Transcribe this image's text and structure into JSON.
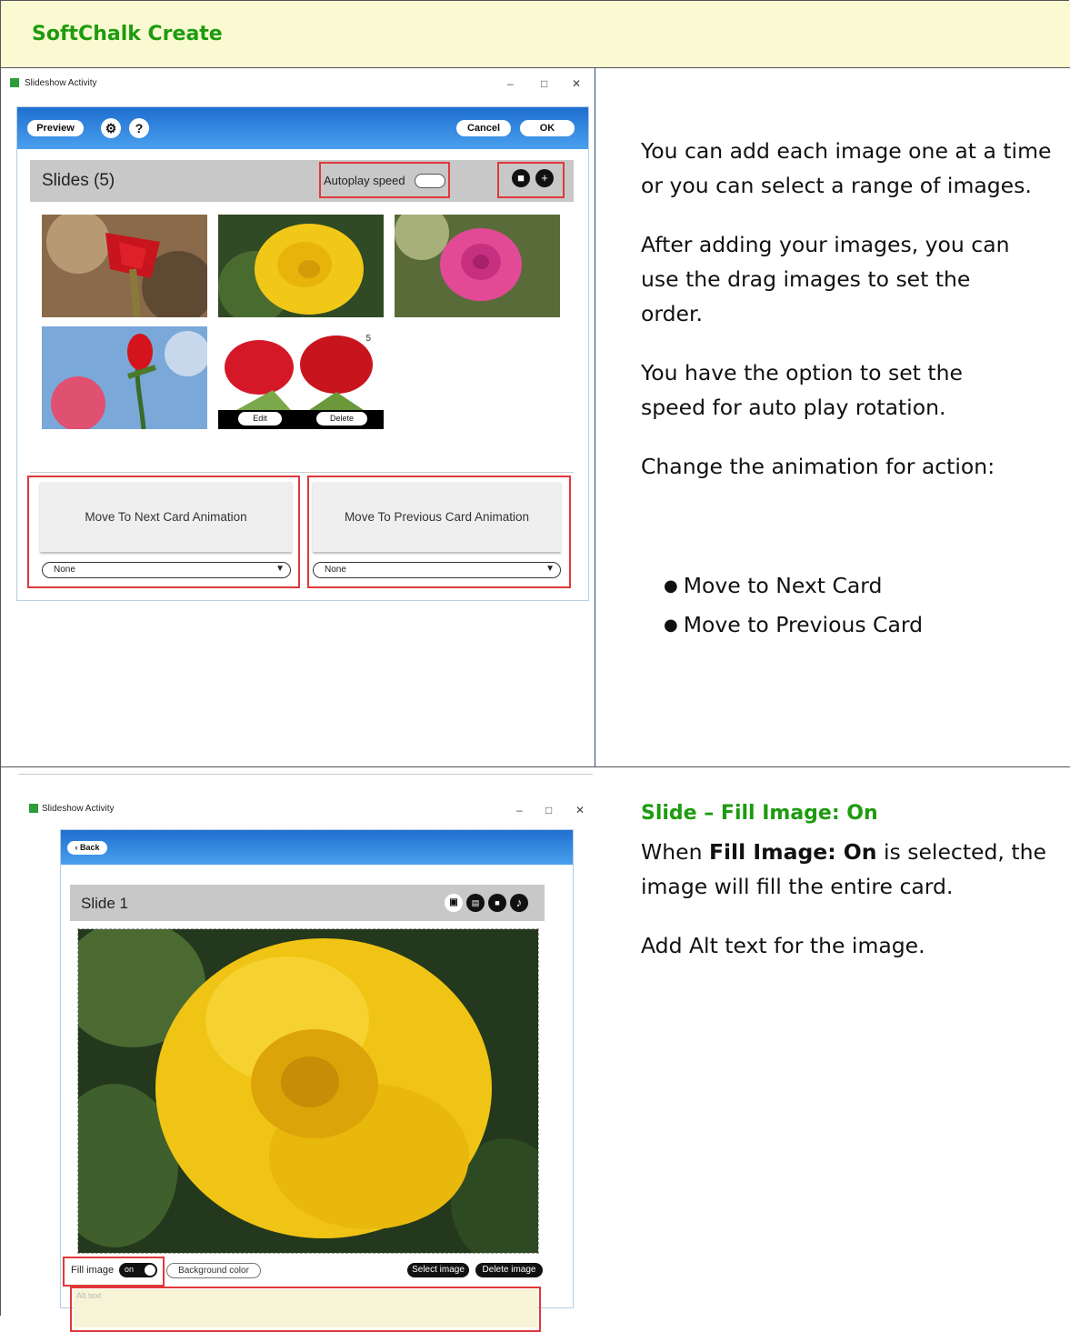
{
  "header": {
    "title": "SoftChalk Create"
  },
  "window1": {
    "title": "Slideshow Activity",
    "controls": [
      "–",
      "□",
      "✕"
    ],
    "toolbar": {
      "preview": "Preview",
      "gear": "⚙",
      "help": "?",
      "cancel": "Cancel",
      "ok": "OK"
    },
    "slides_label": "Slides (5)",
    "autoplay_label": "Autoplay speed",
    "thumb_number": "5",
    "edit_label": "Edit",
    "delete_label": "Delete",
    "next_anim_label": "Move To Next Card Animation",
    "prev_anim_label": "Move To Previous Card Animation",
    "next_anim_value": "None",
    "prev_anim_value": "None"
  },
  "right1": {
    "p1": "You can add each image one at a time or you can select a range of images.",
    "p2": "After adding your images, you can use the drag images to set the order.",
    "p3": "You have the option to set the speed for auto play rotation.",
    "p4": "Change the animation for action:",
    "bullets": [
      "Move to Next Card",
      "Move to Previous Card"
    ]
  },
  "window2": {
    "title": "Slideshow Activity",
    "controls": [
      "–",
      "□",
      "✕"
    ],
    "back": "Back",
    "slide_label": "Slide 1",
    "fill_image_label": "Fill image",
    "fill_toggle": "on",
    "background_color": "Background color",
    "select_image": "Select image",
    "delete_image": "Delete image",
    "alt_placeholder": "Alt text"
  },
  "right2": {
    "heading": "Slide – Fill Image: On",
    "p1_pre": "When ",
    "p1_bold": "Fill Image: On",
    "p1_post": " is selected, the image will fill the entire card.",
    "p2": "Add Alt text for the image."
  },
  "colors": {
    "heading_green": "#1e9b0f",
    "header_bg": "#fafad2",
    "highlight_red": "#e0383a",
    "toolbar_blue": "#2a7fde"
  }
}
